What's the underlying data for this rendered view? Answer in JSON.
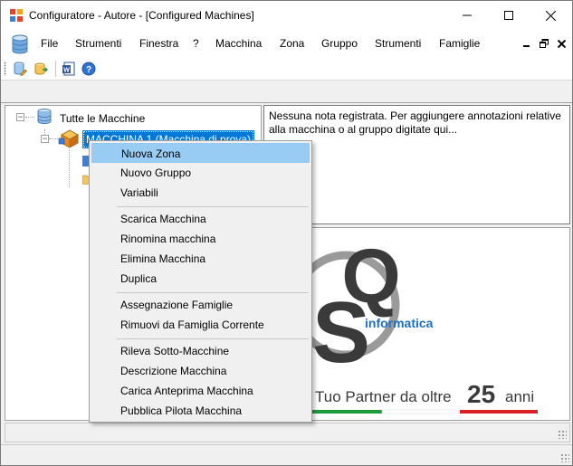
{
  "window": {
    "title": "Configuratore - Autore - [Configured Machines]"
  },
  "menubar": {
    "items": [
      "File",
      "Strumenti",
      "Finestra",
      "?",
      "Macchina",
      "Zona",
      "Gruppo",
      "Strumenti",
      "Famiglie"
    ]
  },
  "tree": {
    "root_label": "Tutte le Macchine",
    "machine_label": "MACCHINA 1 (Macchina di prova)"
  },
  "notes": {
    "text": "Nessuna nota registrata. Per aggiungere annotazioni relative alla macchina o al gruppo digitate qui..."
  },
  "logo": {
    "word": "informatica",
    "tagline": "Tuo Partner da oltre",
    "years_number": "25",
    "years_word": "anni",
    "colors": {
      "green": "#1a9b3c",
      "red": "#d92027",
      "dark": "#3a3a3a",
      "blue": "#1f6fc2"
    }
  },
  "context_menu": {
    "groups": [
      [
        "Nuova Zona",
        "Nuovo Gruppo",
        "Variabili"
      ],
      [
        "Scarica Macchina",
        "Rinomina macchina",
        "Elimina Macchina",
        "Duplica"
      ],
      [
        "Assegnazione Famiglie",
        "Rimuovi da Famiglia Corrente"
      ],
      [
        "Rileva Sotto-Macchine",
        "Descrizione Macchina",
        "Carica Anteprima Macchina",
        "Pubblica Pilota Macchina"
      ]
    ],
    "highlighted": "Nuova Zona"
  },
  "colors": {
    "selection": "#0078d7",
    "menu_hover": "#99ccf3"
  }
}
